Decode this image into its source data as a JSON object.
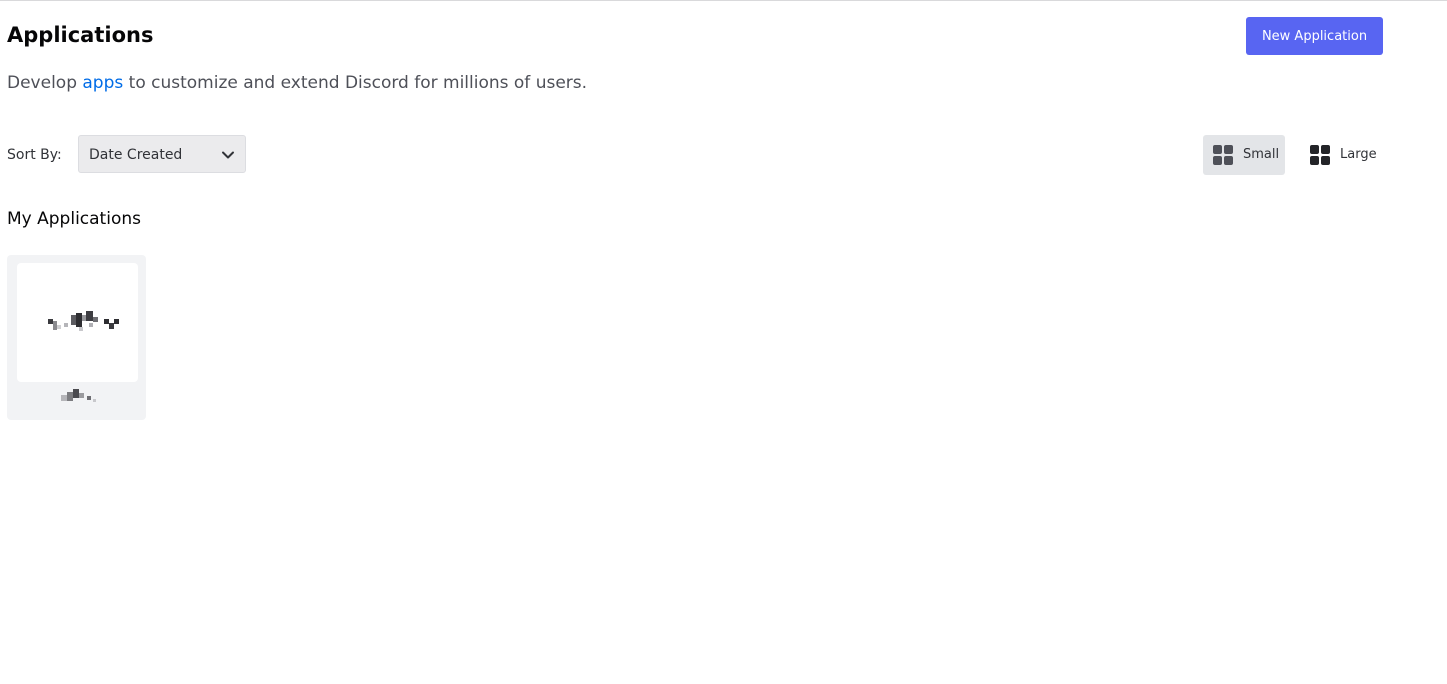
{
  "header": {
    "title": "Applications",
    "new_button_label": "New Application",
    "subtitle_prefix": "Develop ",
    "subtitle_link": "apps",
    "subtitle_suffix": " to customize and extend Discord for millions of users."
  },
  "sort": {
    "label": "Sort By:",
    "selected": "Date Created",
    "chevron_icon": "chevron-down-icon"
  },
  "view_toggle": {
    "small_label": "Small",
    "large_label": "Large",
    "selected": "Small",
    "icon": "grid-icon"
  },
  "section": {
    "title": "My Applications"
  },
  "colors": {
    "accent": "#5865f2",
    "link": "#006ce7",
    "selected_toggle_bg": "#e3e5e8",
    "card_bg": "#f2f3f5"
  }
}
